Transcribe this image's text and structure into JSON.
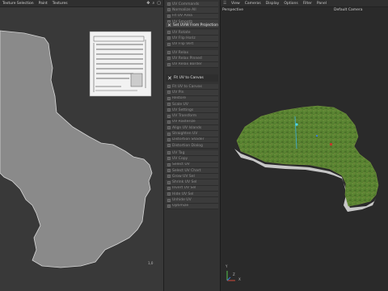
{
  "uv_menu": {
    "items": [
      "Texture Selection",
      "Paint",
      "Textures"
    ]
  },
  "commands": {
    "group1": [
      "UV Commands",
      "Normalize All",
      "Fit UV Area",
      "UV Smooth"
    ],
    "active_item": "Set UVW From Projection",
    "group2": [
      "UV Rotate",
      "UV Flip Horiz",
      "UV Flip Vert"
    ],
    "group3": [
      "UV Relax",
      "UV Relax Pinned",
      "UV Relax Border"
    ],
    "head_label": "Fit UV to Canvas",
    "group4": [
      "Fit UV to Canvas",
      "UV Pin",
      "Restore",
      "Scale UV",
      "UV Settings",
      "UV Transform",
      "UV Rasterize",
      "Align UV Islands",
      "Straighten UV",
      "Distortion Shader",
      "Distortion Dialog"
    ],
    "group5": [
      "UV Tag",
      "UV Copy",
      "Select UV",
      "Select UV Chart",
      "Grow UV Sel",
      "Shrink UV Sel",
      "Invert UV Sel",
      "Hide UV Sel",
      "Unhide UV",
      "Optimize"
    ]
  },
  "uv_scale_label": "1,0",
  "viewport": {
    "menu": [
      "View",
      "Cameras",
      "Display",
      "Options",
      "Filter",
      "Panel"
    ],
    "projection": "Perspective",
    "camera": "Default Camera",
    "axis": {
      "y": "Y",
      "x": "X",
      "z": "Z"
    }
  }
}
